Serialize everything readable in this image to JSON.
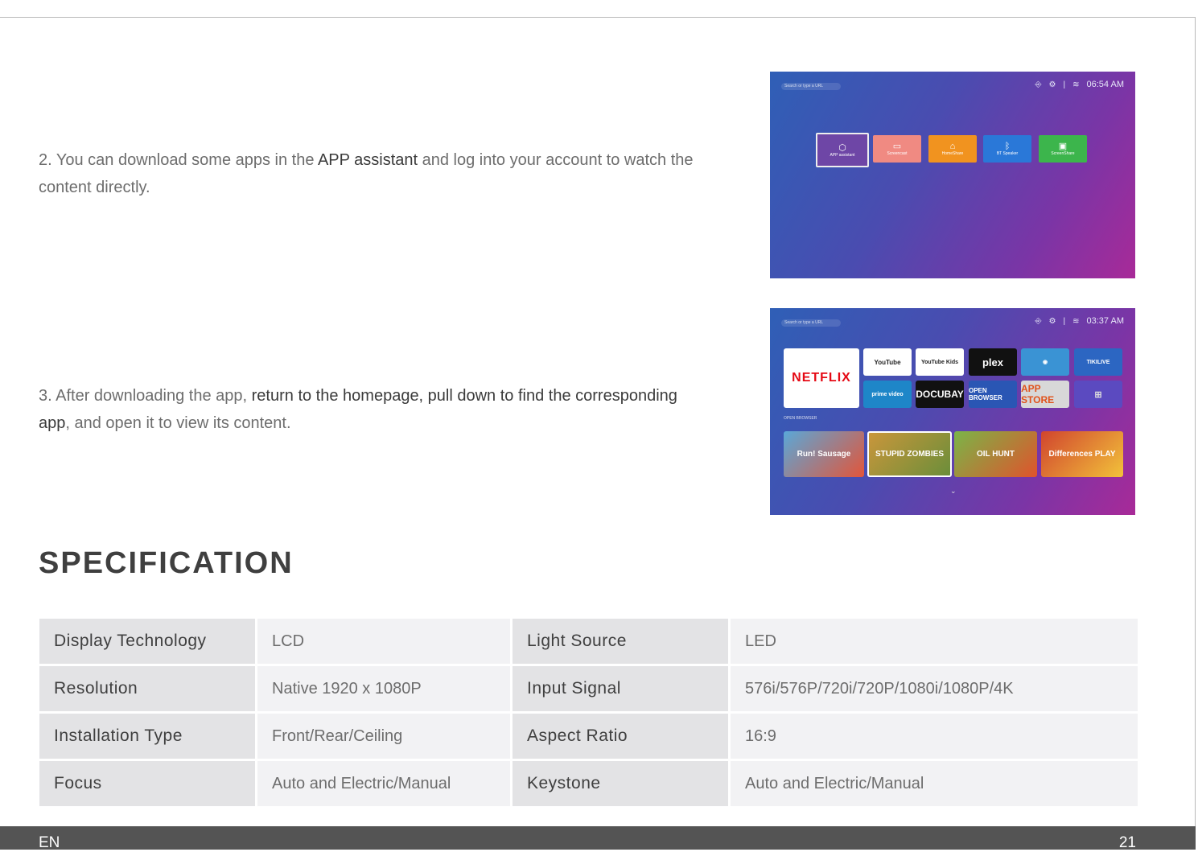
{
  "para2": {
    "prefix": "2. You can download some apps in the ",
    "em": "APP assistant",
    "suffix": " and log into your account to watch the content directly."
  },
  "para3": {
    "prefix": "3. After downloading the app, ",
    "em": "return to the homepage, pull down to find the corresponding app",
    "suffix": ", and open it to view its content."
  },
  "tv1": {
    "search_placeholder": "Search or type a URL",
    "time": "06:54 AM",
    "tiles": [
      "APP assistant",
      "Screencast",
      "HomeShare",
      "BT Speaker",
      "ScreenShare"
    ]
  },
  "tv2": {
    "search_placeholder": "Search or type a URL",
    "time": "03:37 AM",
    "apps": {
      "netflix": "NETFLIX",
      "youtube": "YouTube",
      "youtube_kids": "YouTube Kids",
      "plex": "plex",
      "tikilive": "TIKILIVE",
      "prime": "prime video",
      "docubay": "DOCUBAY",
      "open_browser": "OPEN BROWSER",
      "app_store": "APP STORE"
    },
    "section_label": "OPEN BROWSER",
    "games": [
      "Run! Sausage",
      "STUPID ZOMBIES",
      "OIL HUNT",
      "Differences PLAY"
    ]
  },
  "spec": {
    "title": "SPECIFICATION",
    "rows": [
      [
        "Display Technology",
        "LCD",
        "Light Source",
        "LED"
      ],
      [
        "Resolution",
        "Native 1920 x 1080P",
        "Input Signal",
        "576i/576P/720i/720P/1080i/1080P/4K"
      ],
      [
        "Installation Type",
        "Front/Rear/Ceiling",
        "Aspect Ratio",
        "16:9"
      ],
      [
        "Focus",
        "Auto and Electric/Manual",
        "Keystone",
        "Auto and Electric/Manual"
      ]
    ]
  },
  "footer": {
    "lang": "EN",
    "page": "21"
  },
  "colors": {
    "footer_bg": "#545454",
    "label_cell": "#e3e3e5",
    "value_cell": "#f2f2f4"
  }
}
